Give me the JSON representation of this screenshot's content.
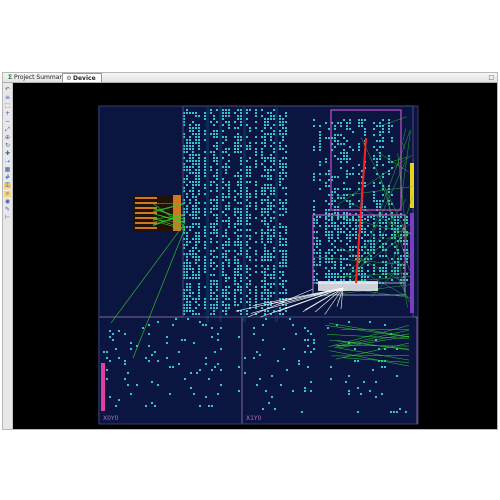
{
  "tabs": [
    {
      "label": "Project Summary",
      "icon": "sigma-icon",
      "close": "×"
    },
    {
      "label": "Device",
      "icon": "gear-icon",
      "close": ""
    }
  ],
  "window_control": "□",
  "toolbar_icons": [
    "undo-icon",
    "list-icon",
    "select-icon",
    "zoom-in-icon",
    "zoom-out-icon",
    "zoom-fit-icon",
    "zoom-area-icon",
    "refresh-icon",
    "add-icon",
    "route-icon",
    "place-icon",
    "grid-icon",
    "lock-icon",
    "search-icon",
    "highlight-icon",
    "pen-icon",
    "ruler-icon"
  ],
  "device": {
    "clock_region_labels": [
      "X0Y0",
      "X1Y0"
    ],
    "colors": {
      "background": "#000000",
      "fabric": "#0b1640",
      "cells": "#35c3d6",
      "region_border": "#7a6a96",
      "highlight_border": "#c84fc8",
      "net_green": "#33cc33",
      "net_white": "#ffffff",
      "net_red": "#ff2020",
      "io_orange": "#d07820",
      "io_yellow": "#e8d020",
      "io_pink": "#e040a0",
      "io_purple": "#7a3cc0"
    }
  }
}
